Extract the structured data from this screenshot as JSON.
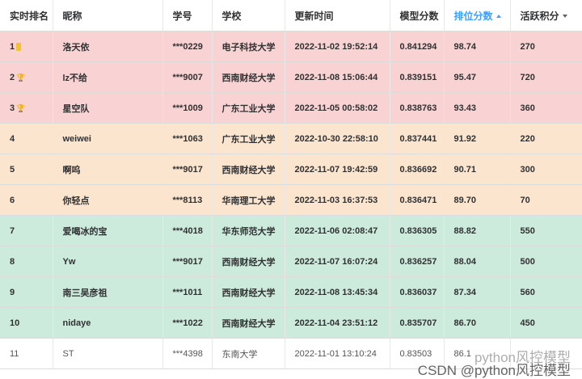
{
  "headers": {
    "rank": "实时排名",
    "nickname": "昵称",
    "student_id": "学号",
    "school": "学校",
    "update_time": "更新时间",
    "model_score": "模型分数",
    "rank_score": "排位分数",
    "active_points": "活跃积分"
  },
  "rows": [
    {
      "rank": "1",
      "medal": "gold",
      "nickname": "洛天依",
      "student_id": "***0229",
      "school": "电子科技大学",
      "update_time": "2022-11-02 19:52:14",
      "model_score": "0.841294",
      "rank_score": "98.74",
      "active_points": "270"
    },
    {
      "rank": "2",
      "medal": "silver",
      "nickname": "lz不给",
      "student_id": "***9007",
      "school": "西南财经大学",
      "update_time": "2022-11-08 15:06:44",
      "model_score": "0.839151",
      "rank_score": "95.47",
      "active_points": "720"
    },
    {
      "rank": "3",
      "medal": "bronze",
      "nickname": "星空队",
      "student_id": "***1009",
      "school": "广东工业大学",
      "update_time": "2022-11-05 00:58:02",
      "model_score": "0.838763",
      "rank_score": "93.43",
      "active_points": "360"
    },
    {
      "rank": "4",
      "nickname": "weiwei",
      "student_id": "***1063",
      "school": "广东工业大学",
      "update_time": "2022-10-30 22:58:10",
      "model_score": "0.837441",
      "rank_score": "91.92",
      "active_points": "220"
    },
    {
      "rank": "5",
      "nickname": "啊呜",
      "student_id": "***9017",
      "school": "西南财经大学",
      "update_time": "2022-11-07 19:42:59",
      "model_score": "0.836692",
      "rank_score": "90.71",
      "active_points": "300"
    },
    {
      "rank": "6",
      "nickname": "你轻点",
      "student_id": "***8113",
      "school": "华南理工大学",
      "update_time": "2022-11-03 16:37:53",
      "model_score": "0.836471",
      "rank_score": "89.70",
      "active_points": "70"
    },
    {
      "rank": "7",
      "nickname": "爱喝冰的宝",
      "student_id": "***4018",
      "school": "华东师范大学",
      "update_time": "2022-11-06 02:08:47",
      "model_score": "0.836305",
      "rank_score": "88.82",
      "active_points": "550"
    },
    {
      "rank": "8",
      "nickname": "Yw",
      "student_id": "***9017",
      "school": "西南财经大学",
      "update_time": "2022-11-07 16:07:24",
      "model_score": "0.836257",
      "rank_score": "88.04",
      "active_points": "500"
    },
    {
      "rank": "9",
      "nickname": "南三吴彦祖",
      "student_id": "***1011",
      "school": "西南财经大学",
      "update_time": "2022-11-08 13:45:34",
      "model_score": "0.836037",
      "rank_score": "87.34",
      "active_points": "560"
    },
    {
      "rank": "10",
      "nickname": "nidaye",
      "student_id": "***1022",
      "school": "西南财经大学",
      "update_time": "2022-11-04 23:51:12",
      "model_score": "0.835707",
      "rank_score": "86.70",
      "active_points": "450"
    },
    {
      "rank": "11",
      "nickname": "ST",
      "student_id": "***4398",
      "school": "东南大学",
      "update_time": "2022-11-01 13:10:24",
      "model_score": "0.83503",
      "rank_score": "86.1",
      "active_points": ""
    }
  ],
  "watermark": {
    "line1": "python风控模型",
    "line2": "CSDN @python风控模型"
  },
  "colors": {
    "gold_row": "#f9d3d3",
    "silver_row": "#fbe5ce",
    "bronze_row": "#cdebdc",
    "sort_active": "#409eff"
  }
}
